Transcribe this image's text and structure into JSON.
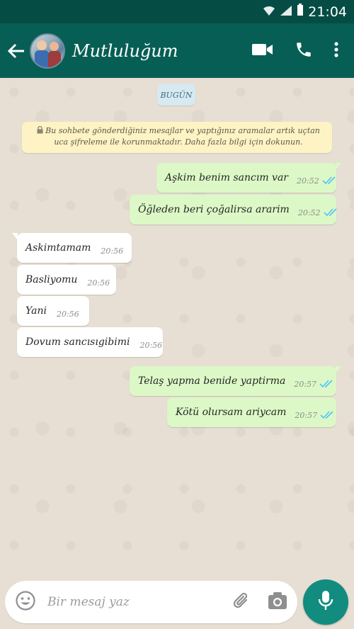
{
  "status_bar": {
    "time": "21:04"
  },
  "header": {
    "title": "Mutluluğum"
  },
  "chat": {
    "date_label": "BUGÜN",
    "encryption_notice": "Bu sohbete gönderdiğiniz mesajlar ve yaptığınız aramalar artık uçtan uca şifreleme ile korunmaktadır. Daha fazla bilgi için dokunun."
  },
  "messages": [
    {
      "direction": "out",
      "text": "Aşkim benim sancım var",
      "time": "20:52"
    },
    {
      "direction": "out",
      "text": "Öğleden beri çoğalirsa ararim",
      "time": "20:52"
    },
    {
      "direction": "in",
      "text": "Askimtamam",
      "time": "20:56"
    },
    {
      "direction": "in",
      "text": "Basliyomu",
      "time": "20:56"
    },
    {
      "direction": "in",
      "text": "Yani",
      "time": "20:56"
    },
    {
      "direction": "in",
      "text": "Dovum sancısıgibimi",
      "time": "20:56"
    },
    {
      "direction": "out",
      "text": "Telaş yapma benide yaptirma",
      "time": "20:57"
    },
    {
      "direction": "out",
      "text": "Kötü olursam ariycam",
      "time": "20:57"
    }
  ],
  "input": {
    "placeholder": "Bir mesaj yaz"
  },
  "colors": {
    "header": "#075e54",
    "outgoing": "#dcf8c6",
    "incoming": "#ffffff",
    "ticks": "#4fc3f7",
    "fab": "#128c7e"
  }
}
